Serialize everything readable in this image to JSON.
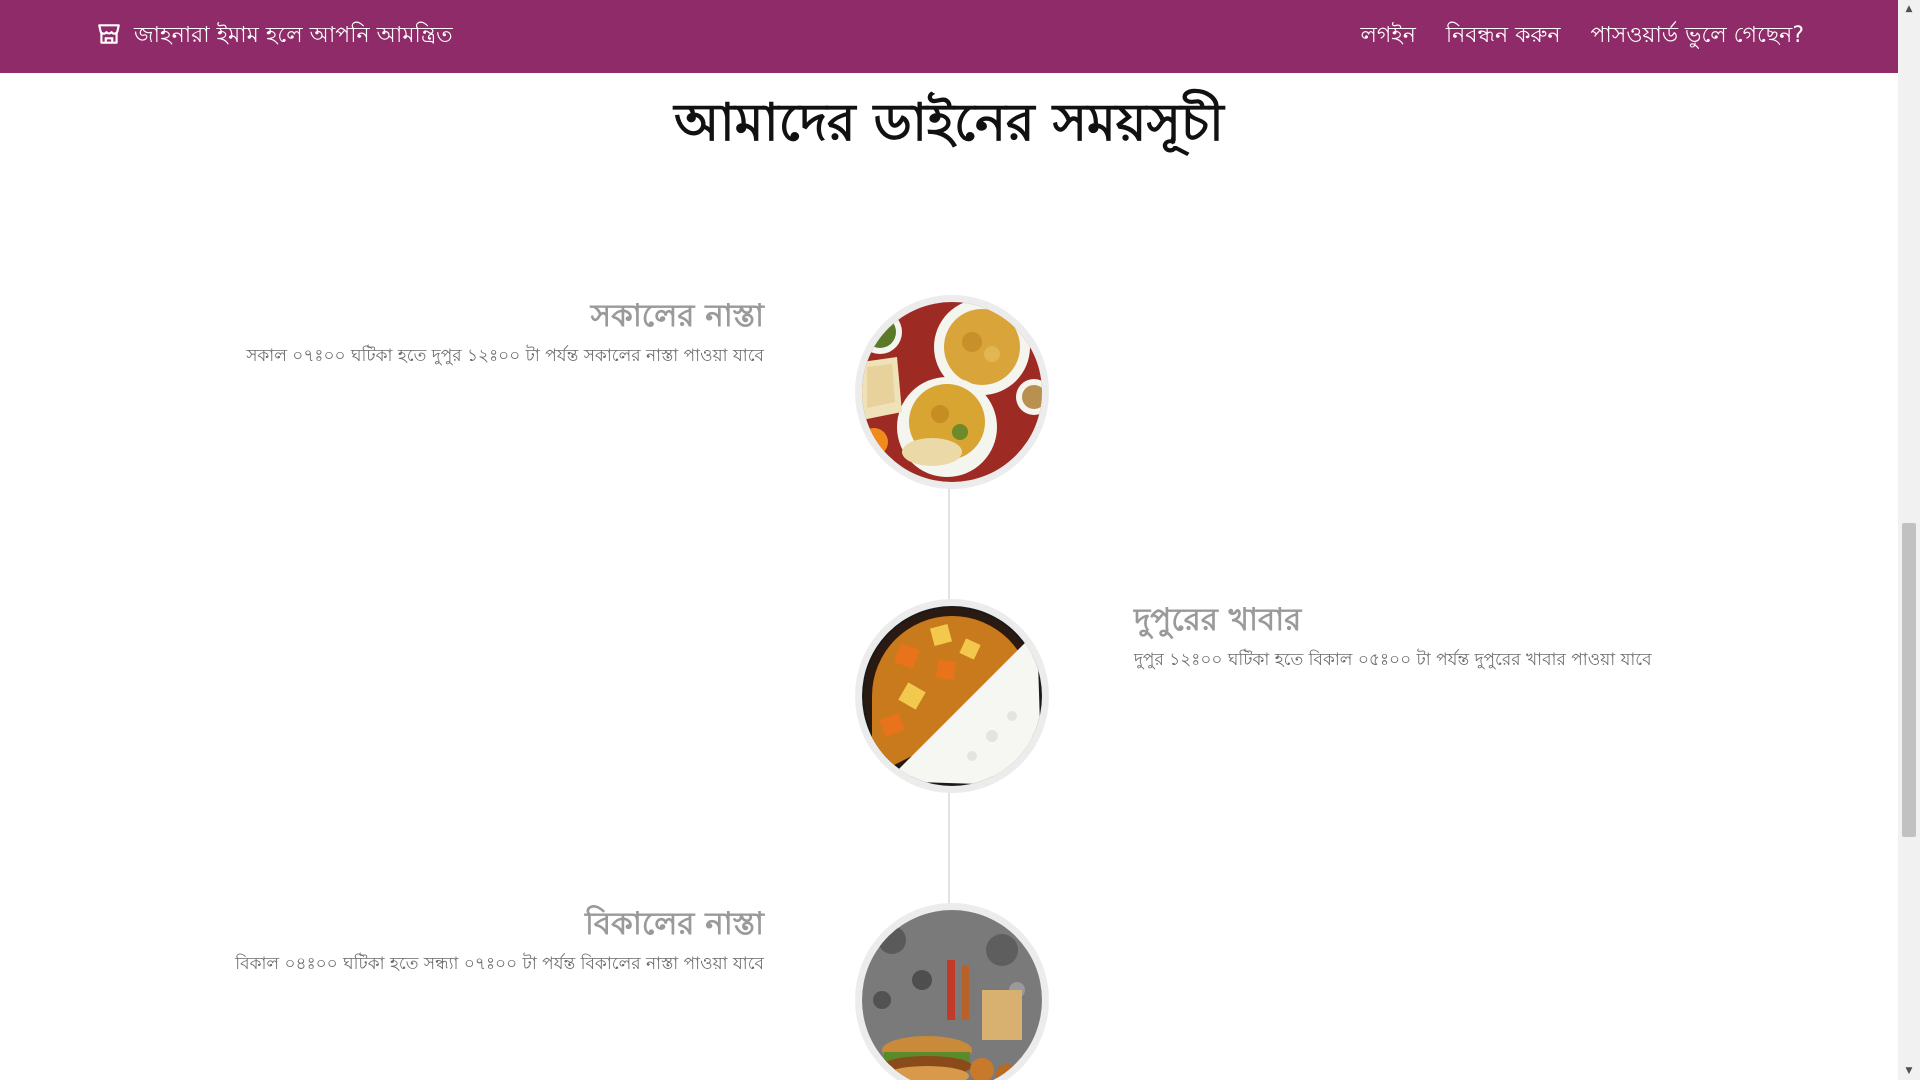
{
  "navbar": {
    "brand_text": "জাহনারা ইমাম হলে আপনি আমন্ত্রিত",
    "brand_icon": "store-icon",
    "links": [
      {
        "label": "লগইন"
      },
      {
        "label": "নিবন্ধন করুন"
      },
      {
        "label": "পাসওয়ার্ড ভুলে গেছেন?"
      }
    ],
    "background_color": "#8e2b68"
  },
  "main": {
    "title": "আমাদের ডাইনের সময়সূচী",
    "meals": [
      {
        "title": "সকালের নাস্তা",
        "description": "সকাল ০৭ঃ০০ ঘটিকা হতে দুপুর ১২ঃ০০ টা পর্যন্ত সকালের নাস্তা পাওয়া যাবে",
        "image": "breakfast-food-image"
      },
      {
        "title": "দুপুরের খাবার",
        "description": "দুপুর ১২ঃ০০ ঘটিকা হতে বিকাল ০৫ঃ০০ টা পর্যন্ত দুপুরের খাবার পাওয়া যাবে",
        "image": "lunch-curry-rice-image"
      },
      {
        "title": "বিকালের নাস্তা",
        "description": "বিকাল ০৪ঃ০০ ঘটিকা হতে সন্ধ্যা ০৭ঃ০০ টা পর্যন্ত বিকালের নাস্তা পাওয়া যাবে",
        "image": "evening-snacks-image"
      }
    ]
  }
}
